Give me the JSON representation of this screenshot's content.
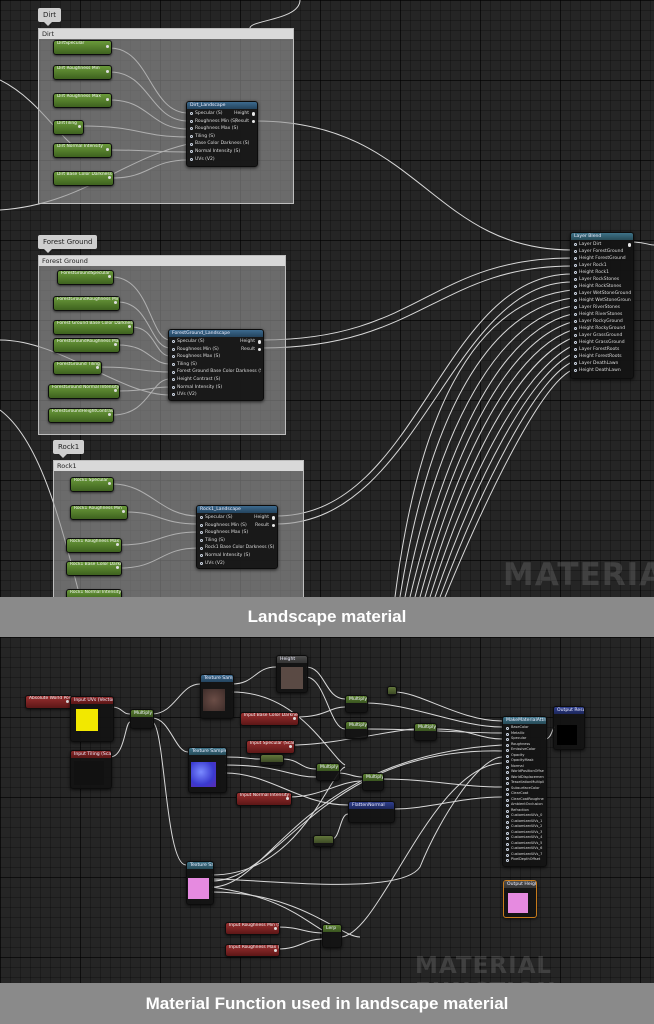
{
  "panel1": {
    "caption": "Landscape material",
    "watermark": "MATERIAL",
    "dirt": {
      "tag": "Dirt",
      "header": "Dirt",
      "params": [
        "DirtSpecular",
        "Dirt Roughness Min",
        "Dirt Roughness Max",
        "DirtTiling",
        "Dirt Normal Intensity",
        "Dirt Base Color Darkness"
      ],
      "function": {
        "title": "Dirt_Landscape",
        "inputs": [
          "Specular (S)",
          "Roughness Min (S)",
          "Roughness Max (S)",
          "Tiling (S)",
          "Base Color Darkness (S)",
          "Normal Intensity (S)",
          "UVs (V2)"
        ],
        "outputs": [
          "Height",
          "Result"
        ]
      }
    },
    "forest": {
      "tag": "Forest Ground",
      "header": "Forest Ground",
      "params": [
        "ForestGroundSpecular",
        "ForestGroundRoughness Min",
        "Forest Ground Base Color Darkness",
        "ForestGroundRoughness Max",
        "ForestGround Tiling",
        "ForestGround Normal Intensity",
        "ForestGroundHeightContrast"
      ],
      "function": {
        "title": "ForestGround_Landscape",
        "inputs": [
          "Specular (S)",
          "Roughness Min (S)",
          "Roughness Max (S)",
          "Tiling (S)",
          "Forest Ground Base Color Darkness (S)",
          "Height Contrast (S)",
          "Normal Intensity (S)",
          "UVs (V2)"
        ],
        "outputs": [
          "Height",
          "Result"
        ]
      }
    },
    "rock": {
      "tag": "Rock1",
      "header": "Rock1",
      "params": [
        "Rock1 Specular",
        "Rock1 Roughness Min",
        "Rock1 Roughness Max",
        "Rock1 Base Color Darkness",
        "Rock1 Normal Intensity"
      ],
      "function": {
        "title": "Rock1_Landscape",
        "inputs": [
          "Specular (S)",
          "Roughness Min (S)",
          "Roughness Max (S)",
          "Tiling (S)",
          "Rock1 Base Color Darkness (S)",
          "Normal Intensity (S)",
          "UVs (V2)"
        ],
        "outputs": [
          "Height",
          "Result"
        ]
      }
    },
    "blend": {
      "title": "Layer Blend",
      "inputs": [
        "Layer Dirt",
        "Layer ForestGround",
        "Height ForestGround",
        "Layer Rock1",
        "Height Rock1",
        "Layer RockStones",
        "Height RockStones",
        "Layer WetStoneGround",
        "Height WetStoneGround",
        "Layer RiverStones",
        "Height RiverStones",
        "Layer RockyGround",
        "Height RockyGround",
        "Layer GrassGround",
        "Height GrassGround",
        "Layer ForestRoots",
        "Height ForestRoots",
        "Layer DeathLawn",
        "Height DeathLawn"
      ]
    }
  },
  "panel2": {
    "caption": "Material Function used in landscape material",
    "watermark": "MATERIAL FUNCTION",
    "world_position": "Absolute World Position",
    "uvs": "Input UVs (Vector2)",
    "tiling": "Input Tiling (Scalar)",
    "multiply": "Multiply",
    "tex1": "Texture Sample",
    "tex2": "Texture Sample",
    "tex3": "Texture Sample",
    "height": "Height",
    "base_color_darkness": "Input Base Color Darkness (Scalar)",
    "specular_in": "Input Specular (Scalar)",
    "normal_intensity": "Input Normal Intensity (Scalar)",
    "rough_min": "Input Roughness Min (Scalar)",
    "rough_max": "Input Roughness Max (Scalar)",
    "flatten": "FlattenNormal",
    "lerp": "Lerp",
    "make_attributes": "MakeMaterialAttributes",
    "output_result": "Output Result",
    "output_height": "Output Height",
    "attribute_pins": [
      "BaseColor",
      "Metallic",
      "Specular",
      "Roughness",
      "EmissiveColor",
      "Opacity",
      "OpacityMask",
      "Normal",
      "WorldPositionOffset",
      "WorldDisplacement",
      "TessellationMultiplier",
      "SubsurfaceColor",
      "ClearCoat",
      "ClearCoatRoughness",
      "AmbientOcclusion",
      "Refraction",
      "CustomizedUVs_0",
      "CustomizedUVs_1",
      "CustomizedUVs_2",
      "CustomizedUVs_3",
      "CustomizedUVs_4",
      "CustomizedUVs_5",
      "CustomizedUVs_6",
      "CustomizedUVs_7",
      "PixelDepthOffset"
    ]
  }
}
